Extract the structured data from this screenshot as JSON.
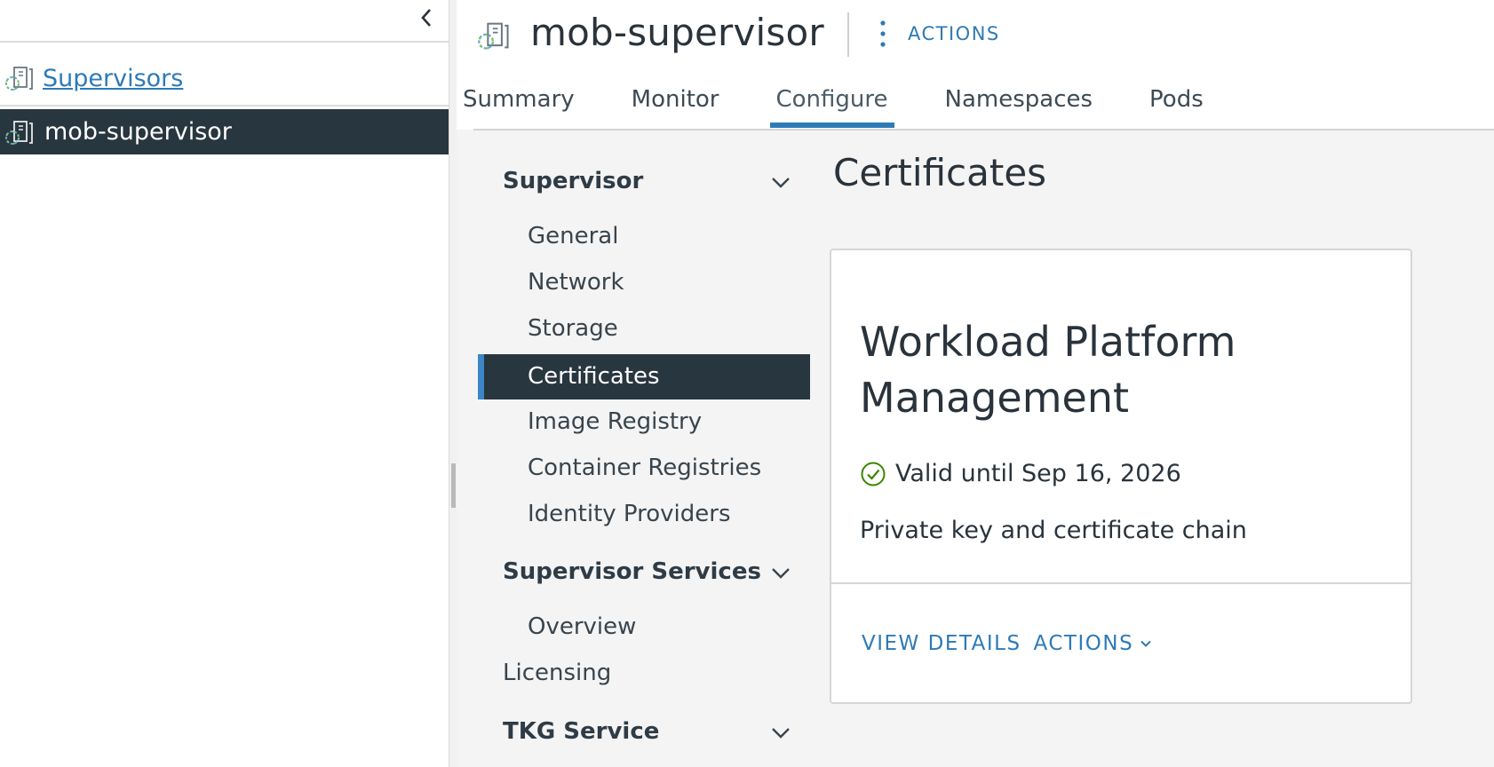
{
  "navigator": {
    "breadcrumb_link": "Supervisors",
    "selected_item": "mob-supervisor"
  },
  "object": {
    "title": "mob-supervisor",
    "actions_label": "ACTIONS"
  },
  "tabs": [
    {
      "label": "Summary",
      "active": false
    },
    {
      "label": "Monitor",
      "active": false
    },
    {
      "label": "Configure",
      "active": true
    },
    {
      "label": "Namespaces",
      "active": false
    },
    {
      "label": "Pods",
      "active": false
    }
  ],
  "configure_nav": {
    "supervisor_group": "Supervisor",
    "supervisor_items": [
      "General",
      "Network",
      "Storage",
      "Certificates",
      "Image Registry",
      "Container Registries",
      "Identity Providers"
    ],
    "active_item": "Certificates",
    "services_group": "Supervisor Services",
    "services_items": [
      "Overview"
    ],
    "licensing": "Licensing",
    "tkg_group": "TKG Service"
  },
  "content": {
    "heading": "Certificates",
    "card": {
      "title": "Workload Platform Management",
      "status": "Valid until Sep 16, 2026",
      "description": "Private key and certificate chain",
      "view_details": "VIEW DETAILS",
      "actions": "ACTIONS"
    }
  },
  "colors": {
    "accent": "#2e7ab6",
    "selected_bg": "#283640",
    "valid_green": "#3c8500"
  }
}
